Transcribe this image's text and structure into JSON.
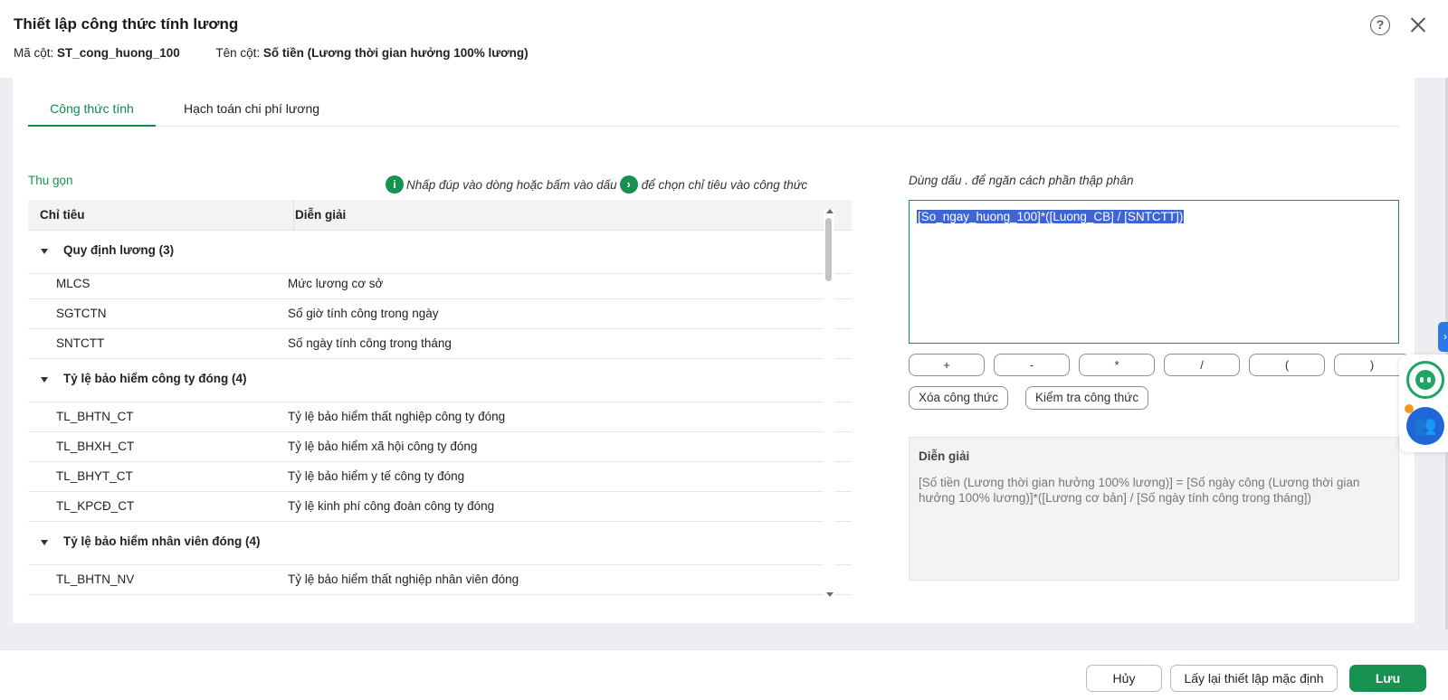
{
  "dialog": {
    "title": "Thiết lập công thức tính lương",
    "column_code_label": "Mã cột:",
    "column_code_value": "ST_cong_huong_100",
    "column_name_label": "Tên cột:",
    "column_name_value": "Số tiền (Lương thời gian hưởng 100% lương)",
    "help_icon": "?"
  },
  "tabs": [
    {
      "label": "Công thức tính",
      "active": true
    },
    {
      "label": "Hạch toán chi phí lương",
      "active": false
    }
  ],
  "left_panel": {
    "collapse_label": "Thu gọn",
    "hint_part1": "Nhấp đúp vào dòng hoặc bấm vào dấu",
    "hint_part2": "để chọn chỉ tiêu vào công thức",
    "info_icon": "i",
    "arrow_icon": "›",
    "columns": [
      "Chỉ tiêu",
      "Diễn giải"
    ],
    "groups": [
      {
        "name": "Quy định lương (3)",
        "items": [
          {
            "code": "MLCS",
            "desc": "Mức lương cơ sở"
          },
          {
            "code": "SGTCTN",
            "desc": "Số giờ tính công trong ngày"
          },
          {
            "code": "SNTCTT",
            "desc": "Số ngày tính công trong tháng"
          }
        ]
      },
      {
        "name": "Tỷ lệ bảo hiểm công ty đóng (4)",
        "items": [
          {
            "code": "TL_BHTN_CT",
            "desc": "Tỷ lệ bảo hiểm thất nghiệp công ty đóng"
          },
          {
            "code": "TL_BHXH_CT",
            "desc": "Tỷ lệ bảo hiểm xã hội công ty đóng"
          },
          {
            "code": "TL_BHYT_CT",
            "desc": "Tỷ lệ bảo hiểm y tế công ty đóng"
          },
          {
            "code": "TL_KPCĐ_CT",
            "desc": "Tỷ lệ kinh phí công đoàn công ty đóng"
          }
        ]
      },
      {
        "name": "Tỷ lệ bảo hiểm nhân viên đóng (4)",
        "items": [
          {
            "code": "TL_BHTN_NV",
            "desc": "Tỷ lệ bảo hiểm thất nghiệp nhân viên đóng"
          }
        ]
      }
    ]
  },
  "right_panel": {
    "decimal_note": "Dùng dấu . để ngăn cách phần thập phân",
    "formula": "[So_ngay_huong_100]*([Luong_CB] / [SNTCTT])",
    "operators": [
      "+",
      "-",
      "*",
      "/",
      "(",
      ")"
    ],
    "clear_button": "Xóa công thức",
    "check_button": "Kiểm tra công thức",
    "explain_label": "Diễn giải",
    "explain_text": "[Số tiền (Lương thời gian hưởng 100% lương)] = [Số ngày công (Lương thời gian hưởng 100% lương)]*([Lương cơ bản] / [Số ngày tính công trong tháng])"
  },
  "side_widgets": {
    "toggle_glyph": "›",
    "team_glyph": "👥"
  },
  "footer": {
    "cancel": "Hủy",
    "reset": "Lấy lại thiết lập mặc định",
    "save": "Lưu"
  },
  "colors": {
    "accent": "#17914f",
    "selection": "#3e65d6",
    "toggle": "#2979e8"
  }
}
